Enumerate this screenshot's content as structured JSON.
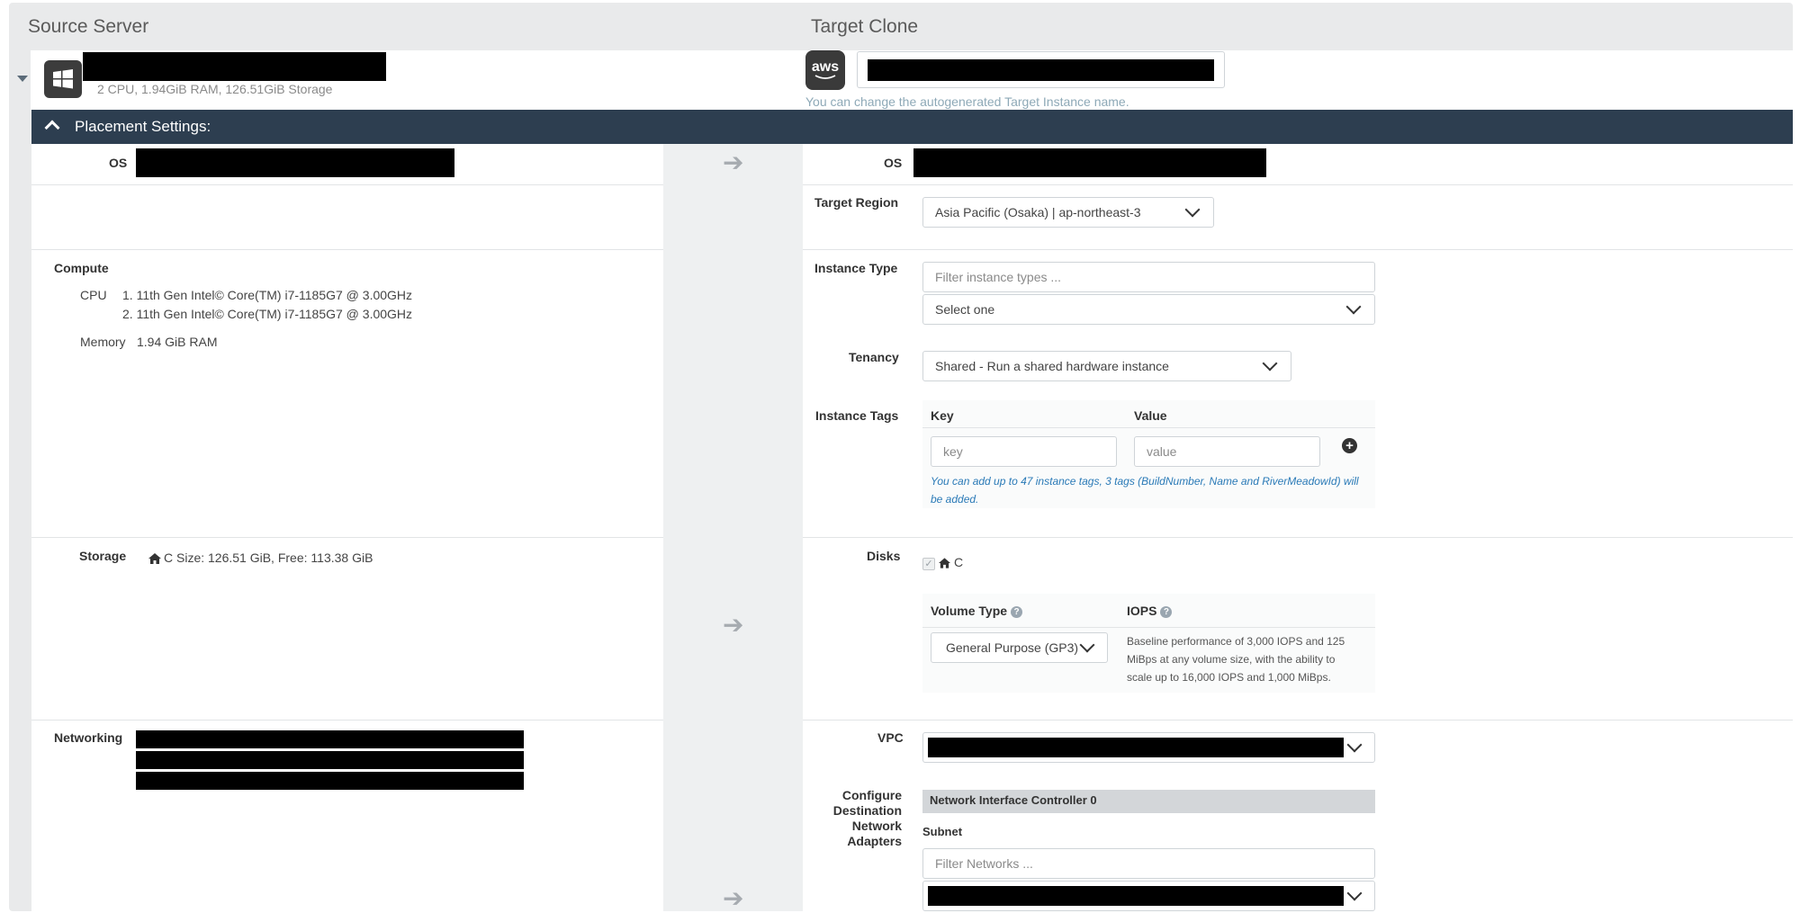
{
  "headers": {
    "source": "Source Server",
    "target": "Target Clone"
  },
  "source_server": {
    "specs": "2 CPU, 1.94GiB RAM, 126.51GiB Storage",
    "os_icon": "windows-icon"
  },
  "target_clone": {
    "provider_icon_text": "aws",
    "name_hint": "You can change the autogenerated Target Instance name."
  },
  "placement": {
    "title": "Placement Settings:"
  },
  "left": {
    "os_label": "OS",
    "compute_label": "Compute",
    "cpu_label": "CPU",
    "cpus": [
      "1. 11th Gen Intel© Core(TM) i7-1185G7 @ 3.00GHz",
      "2. 11th Gen Intel© Core(TM) i7-1185G7 @ 3.00GHz"
    ],
    "memory_label": "Memory",
    "memory_value": "1.94 GiB RAM",
    "storage_label": "Storage",
    "storage_value": "C Size: 126.51 GiB, Free: 113.38 GiB",
    "networking_label": "Networking"
  },
  "right": {
    "os_label": "OS",
    "region_label": "Target Region",
    "region_value": "Asia Pacific (Osaka) | ap-northeast-3",
    "instance_type_label": "Instance Type",
    "instance_filter_placeholder": "Filter instance types ...",
    "instance_select_value": "Select one",
    "tenancy_label": "Tenancy",
    "tenancy_value": "Shared - Run a shared hardware instance",
    "tags_label": "Instance Tags",
    "tags_key_header": "Key",
    "tags_value_header": "Value",
    "tags_key_placeholder": "key",
    "tags_value_placeholder": "value",
    "tags_note": "You can add up to 47 instance tags, 3 tags (BuildNumber, Name and RiverMeadowId) will be added.",
    "disks_label": "Disks",
    "disk_name": "C",
    "volume_type_label": "Volume Type",
    "volume_type_value": "General Purpose (GP3)",
    "iops_label": "IOPS",
    "iops_note": "Baseline performance of 3,000 IOPS and 125 MiBps at any volume size, with the ability to scale up to 16,000 IOPS and 1,000 MiBps.",
    "vpc_label": "VPC",
    "adapters_label": "Configure Destination Network Adapters",
    "nic_title": "Network Interface Controller 0",
    "subnet_label": "Subnet",
    "subnet_filter_placeholder": "Filter Networks ..."
  },
  "colors": {
    "bar": "#2d3e50",
    "link_blue": "#2a7ab7",
    "redaction": "#000000"
  }
}
